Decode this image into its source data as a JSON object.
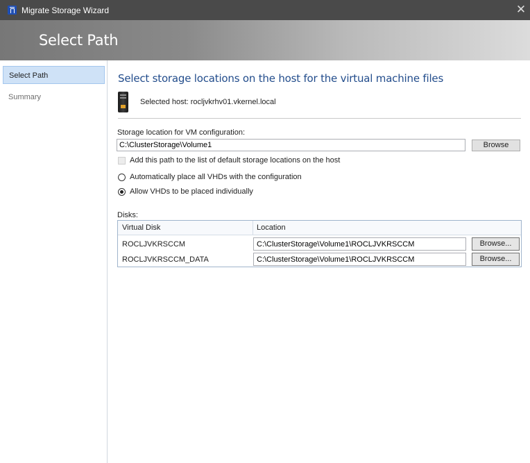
{
  "window": {
    "title": "Migrate Storage Wizard",
    "close_glyph": "✕",
    "icon": "hyper-v-manager-icon"
  },
  "banner": {
    "title": "Select Path"
  },
  "sidebar": {
    "items": [
      {
        "label": "Select Path",
        "active": true
      },
      {
        "label": "Summary",
        "active": false
      }
    ]
  },
  "content": {
    "heading": "Select storage locations on the host for the virtual machine files",
    "host": {
      "label": "Selected host:",
      "value": "rocljvkrhv01.vkernel.local",
      "icon": "server-icon"
    },
    "storage": {
      "label": "Storage location for VM configuration:",
      "value": "C:\\ClusterStorage\\Volume1",
      "browse_label": "Browse"
    },
    "add_default_path": {
      "label": "Add this path to the list of default storage locations on the host",
      "checked": false,
      "enabled": false
    },
    "vhd_placement": {
      "options": [
        {
          "label": "Automatically place all VHDs with the configuration",
          "selected": false
        },
        {
          "label": "Allow VHDs to be placed individually",
          "selected": true
        }
      ]
    },
    "disks": {
      "label": "Disks:",
      "columns": [
        "Virtual Disk",
        "Location"
      ],
      "rows": [
        {
          "name": "ROCLJVKRSCCM",
          "location": "C:\\ClusterStorage\\Volume1\\ROCLJVKRSCCM",
          "browse_label": "Browse..."
        },
        {
          "name": "ROCLJVKRSCCM_DATA",
          "location": "C:\\ClusterStorage\\Volume1\\ROCLJVKRSCCM",
          "browse_label": "Browse..."
        }
      ]
    }
  },
  "colors": {
    "titlebar": "#4a4a4a",
    "heading": "#234d8c",
    "nav_active_bg": "#cfe2f7",
    "nav_active_border": "#a3c6ee"
  }
}
